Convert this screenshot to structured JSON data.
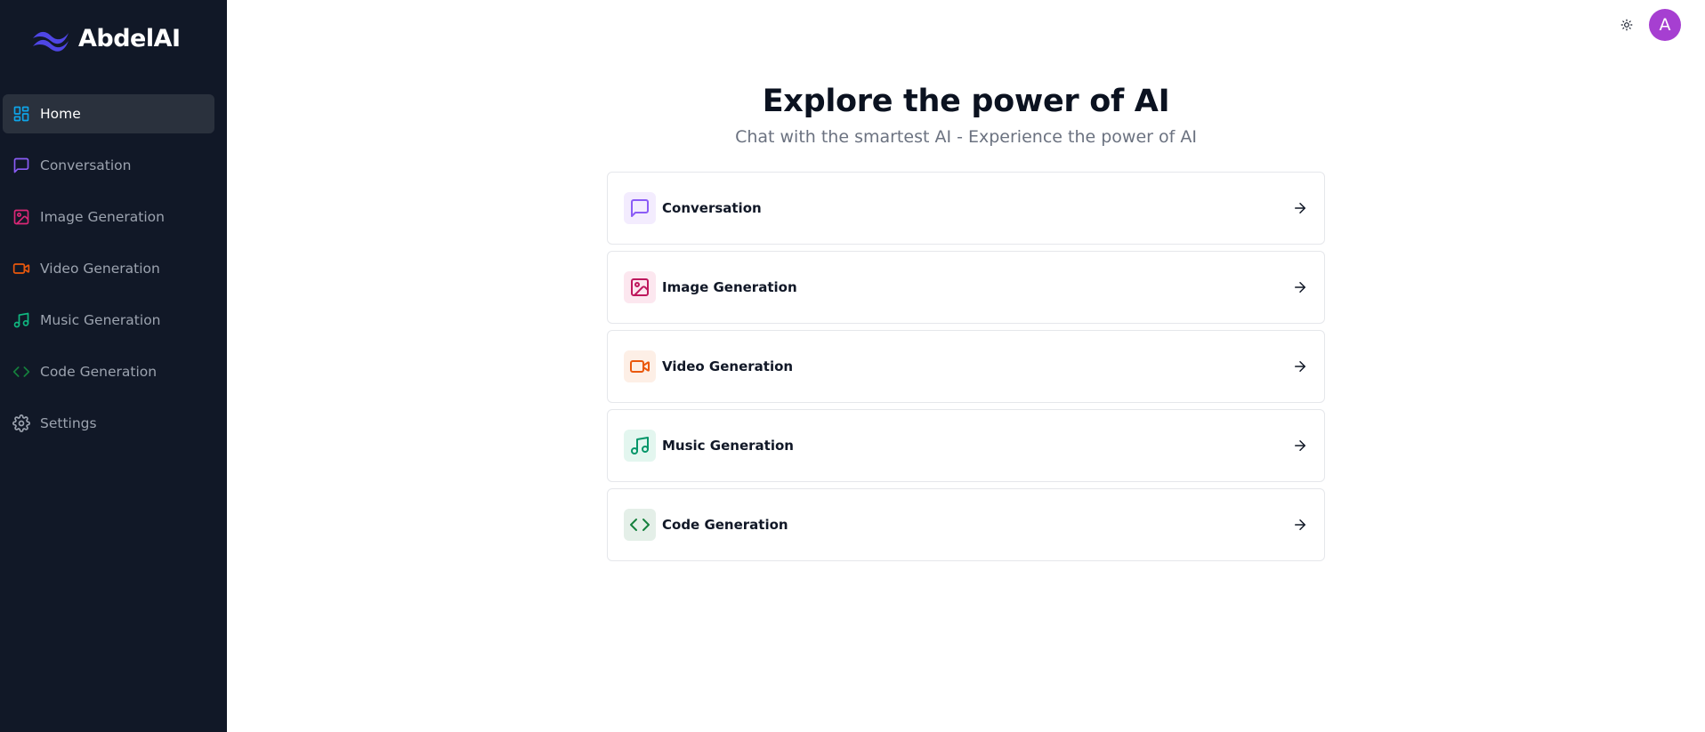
{
  "brand": {
    "name": "AbdelAI"
  },
  "sidebar": {
    "items": [
      {
        "label": "Home",
        "icon": "layout-dashboard-icon",
        "color": "#0ea5e9",
        "active": true
      },
      {
        "label": "Conversation",
        "icon": "message-square-icon",
        "color": "#8b5cf6"
      },
      {
        "label": "Image Generation",
        "icon": "image-icon",
        "color": "#db2777"
      },
      {
        "label": "Video Generation",
        "icon": "video-icon",
        "color": "#ea580c"
      },
      {
        "label": "Music Generation",
        "icon": "music-icon",
        "color": "#10b981"
      },
      {
        "label": "Code Generation",
        "icon": "code-icon",
        "color": "#15803d"
      },
      {
        "label": "Settings",
        "icon": "settings-icon",
        "color": "#9ca3af"
      }
    ]
  },
  "topbar": {
    "theme_icon": "sun-icon",
    "avatar_initial": "A",
    "avatar_color": "#a63fd1"
  },
  "hero": {
    "title": "Explore the power of AI",
    "subtitle": "Chat with the smartest AI - Experience the power of AI"
  },
  "tools": [
    {
      "label": "Conversation",
      "icon": "message-square-icon",
      "color": "#8b5cf6",
      "bg": "#f3ecfe"
    },
    {
      "label": "Image Generation",
      "icon": "image-icon",
      "color": "#be185d",
      "bg": "#fce7ef"
    },
    {
      "label": "Video Generation",
      "icon": "video-icon",
      "color": "#ea580c",
      "bg": "#fdefe6"
    },
    {
      "label": "Music Generation",
      "icon": "music-icon",
      "color": "#059669",
      "bg": "#e3f6ef"
    },
    {
      "label": "Code Generation",
      "icon": "code-icon",
      "color": "#15803d",
      "bg": "#e4efe8"
    }
  ],
  "colors": {
    "sidebar_bg": "#111827",
    "sidebar_active_bg": "#2a313d",
    "brand_accent": "#4f46e5"
  }
}
